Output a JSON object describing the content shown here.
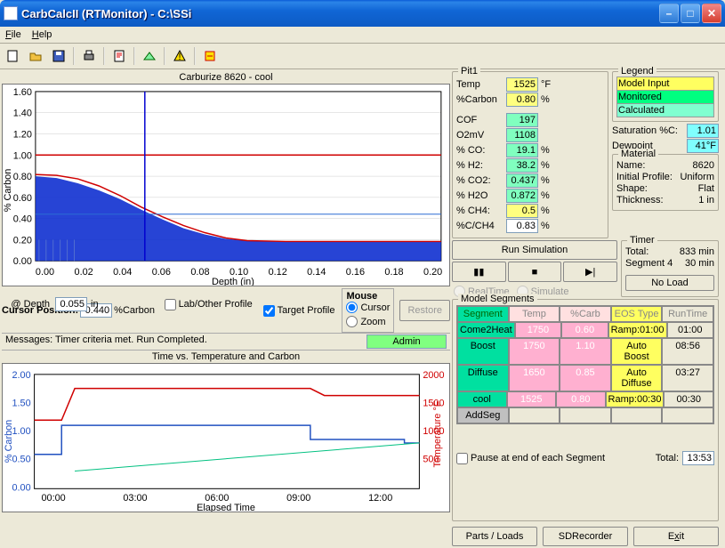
{
  "window": {
    "title": "CarbCalcII (RTMonitor) - C:\\SSi"
  },
  "menu": {
    "file": "File",
    "help": "Help"
  },
  "chart1": {
    "title": "Carburize 8620 - cool",
    "ylabel": "% Carbon",
    "xlabel": "Depth (in)"
  },
  "cursor": {
    "lbl": "Cursor Position:",
    "carbon": "0.440",
    "carbon_unit": "%Carbon",
    "depth_lbl": "@ Depth",
    "depth": "0.055",
    "depth_unit": "in"
  },
  "options": {
    "target": "Target Profile",
    "lab": "Lab/Other Profile",
    "mouse": "Mouse",
    "cur": "Cursor",
    "zoom": "Zoom",
    "restore": "Restore"
  },
  "msg": {
    "text": "Messages: Timer criteria met.  Run Completed.",
    "admin": "Admin"
  },
  "chart2": {
    "title": "Time vs. Temperature and Carbon",
    "ylabel": "% Carbon",
    "y2label": "Temperature °F",
    "xlabel": "Elapsed Time"
  },
  "pit": {
    "title": "Pit1",
    "temp_lbl": "Temp",
    "temp": "1525",
    "temp_unit": "°F",
    "carbon_lbl": "%Carbon",
    "carbon": "0.80",
    "pct": "%",
    "cof_lbl": "COF",
    "cof": "197",
    "o2_lbl": "O2mV",
    "o2": "1108",
    "co_lbl": "% CO:",
    "co": "19.1",
    "h2_lbl": "% H2:",
    "h2": "38.2",
    "co2_lbl": "% CO2:",
    "co2": "0.437",
    "h2o_lbl": "% H2O",
    "h2o": "0.872",
    "ch4_lbl": "% CH4:",
    "ch4": "0.5",
    "cch4_lbl": "%C/CH4",
    "cch4": "0.83"
  },
  "legend": {
    "title": "Legend",
    "m1": "Model Input",
    "m2": "Monitored",
    "m3": "Calculated"
  },
  "sat": {
    "lbl": "Saturation %C:",
    "val": "1.01",
    "dp_lbl": "Dewpoint",
    "dp": "41°F"
  },
  "material": {
    "title": "Material",
    "name_lbl": "Name:",
    "name": "8620",
    "prof_lbl": "Initial Profile:",
    "prof": "Uniform",
    "shape_lbl": "Shape:",
    "shape": "Flat",
    "thick_lbl": "Thickness:",
    "thick": "1 in"
  },
  "sim": {
    "run": "Run Simulation",
    "rt": "RealTime",
    "sim": "Simulate",
    "noload": "No Load"
  },
  "timer": {
    "title": "Timer",
    "tot_lbl": "Total:",
    "tot": "833 min",
    "seg_lbl": "Segment 4",
    "seg": "30 min"
  },
  "segments": {
    "title": "Model Segments",
    "h1": "Segment",
    "h2": "Temp",
    "h3": "%Carb",
    "h4": "EOS Type",
    "h5": "RunTime",
    "rows": [
      {
        "seg": "Come2Heat",
        "temp": "1750",
        "carb": "0.60",
        "eos": "Ramp:01:00",
        "rt": "01:00"
      },
      {
        "seg": "Boost",
        "temp": "1750",
        "carb": "1.10",
        "eos": "Auto Boost",
        "rt": "08:56"
      },
      {
        "seg": "Diffuse",
        "temp": "1650",
        "carb": "0.85",
        "eos": "Auto Diffuse",
        "rt": "03:27"
      },
      {
        "seg": "cool",
        "temp": "1525",
        "carb": "0.80",
        "eos": "Ramp:00:30",
        "rt": "00:30"
      }
    ],
    "add": "AddSeg ",
    "pause": "Pause at end of each Segment",
    "tot_lbl": "Total:",
    "tot": "13:53"
  },
  "buttons": {
    "parts": "Parts / Loads",
    "sd": "SDRecorder",
    "exit": "Exit"
  },
  "chart_data": [
    {
      "type": "area",
      "title": "Carburize 8620 - cool",
      "xlabel": "Depth (in)",
      "ylabel": "% Carbon",
      "xlim": [
        0,
        0.2
      ],
      "ylim": [
        0,
        1.6
      ],
      "series": [
        {
          "name": "Fill",
          "fill": true,
          "color": "#1030d0",
          "x": [
            0,
            0.01,
            0.02,
            0.03,
            0.04,
            0.05,
            0.06,
            0.07,
            0.08,
            0.09,
            0.1,
            0.12,
            0.14,
            0.16,
            0.18,
            0.2
          ],
          "y": [
            0.8,
            0.78,
            0.74,
            0.68,
            0.6,
            0.5,
            0.42,
            0.34,
            0.28,
            0.24,
            0.21,
            0.2,
            0.2,
            0.2,
            0.2,
            0.2
          ]
        },
        {
          "name": "Target",
          "color": "#d00000",
          "x": [
            0,
            0.01,
            0.02,
            0.03,
            0.04,
            0.05,
            0.06,
            0.07,
            0.08,
            0.09,
            0.1,
            0.12,
            0.14,
            0.16,
            0.18,
            0.2
          ],
          "y": [
            0.82,
            0.81,
            0.78,
            0.72,
            0.64,
            0.54,
            0.45,
            0.37,
            0.3,
            0.25,
            0.22,
            0.2,
            0.2,
            0.2,
            0.2,
            0.2
          ]
        },
        {
          "name": "Saturation",
          "color": "#d00000",
          "x": [
            0,
            0.2
          ],
          "y": [
            1.0,
            1.0
          ]
        },
        {
          "name": "Cursor",
          "color": "#0000d0",
          "x": [
            0.055,
            0.055
          ],
          "y": [
            0,
            1.6
          ]
        },
        {
          "name": "Lower",
          "color": "#2a6cd4",
          "x": [
            0,
            0.2
          ],
          "y": [
            0.44,
            0.44
          ]
        }
      ]
    },
    {
      "type": "line",
      "title": "Time vs. Temperature and Carbon",
      "xlabel": "Elapsed Time",
      "ylabel": "% Carbon",
      "y2label": "Temperature °F",
      "x_ticks": [
        "00:00",
        "03:00",
        "06:00",
        "09:00",
        "12:00"
      ],
      "xlim": [
        0,
        14
      ],
      "ylim": [
        0,
        2.0
      ],
      "y2lim": [
        0,
        2000
      ],
      "series": [
        {
          "name": "Temp",
          "axis": "y2",
          "color": "#d00000",
          "x": [
            0,
            1,
            1.5,
            10,
            10.5,
            14
          ],
          "y": [
            1200,
            1200,
            1750,
            1750,
            1650,
            1650
          ]
        },
        {
          "name": "%Carbon set",
          "axis": "y",
          "color": "#2050c0",
          "x": [
            0,
            1,
            1.5,
            10,
            10.5,
            13.5,
            14
          ],
          "y": [
            0.6,
            0.6,
            1.1,
            1.1,
            0.85,
            0.85,
            0.8
          ]
        },
        {
          "name": "%Carbon actual",
          "axis": "y",
          "color": "#00c080",
          "x": [
            1.5,
            14
          ],
          "y": [
            0.3,
            0.8
          ]
        }
      ]
    }
  ]
}
